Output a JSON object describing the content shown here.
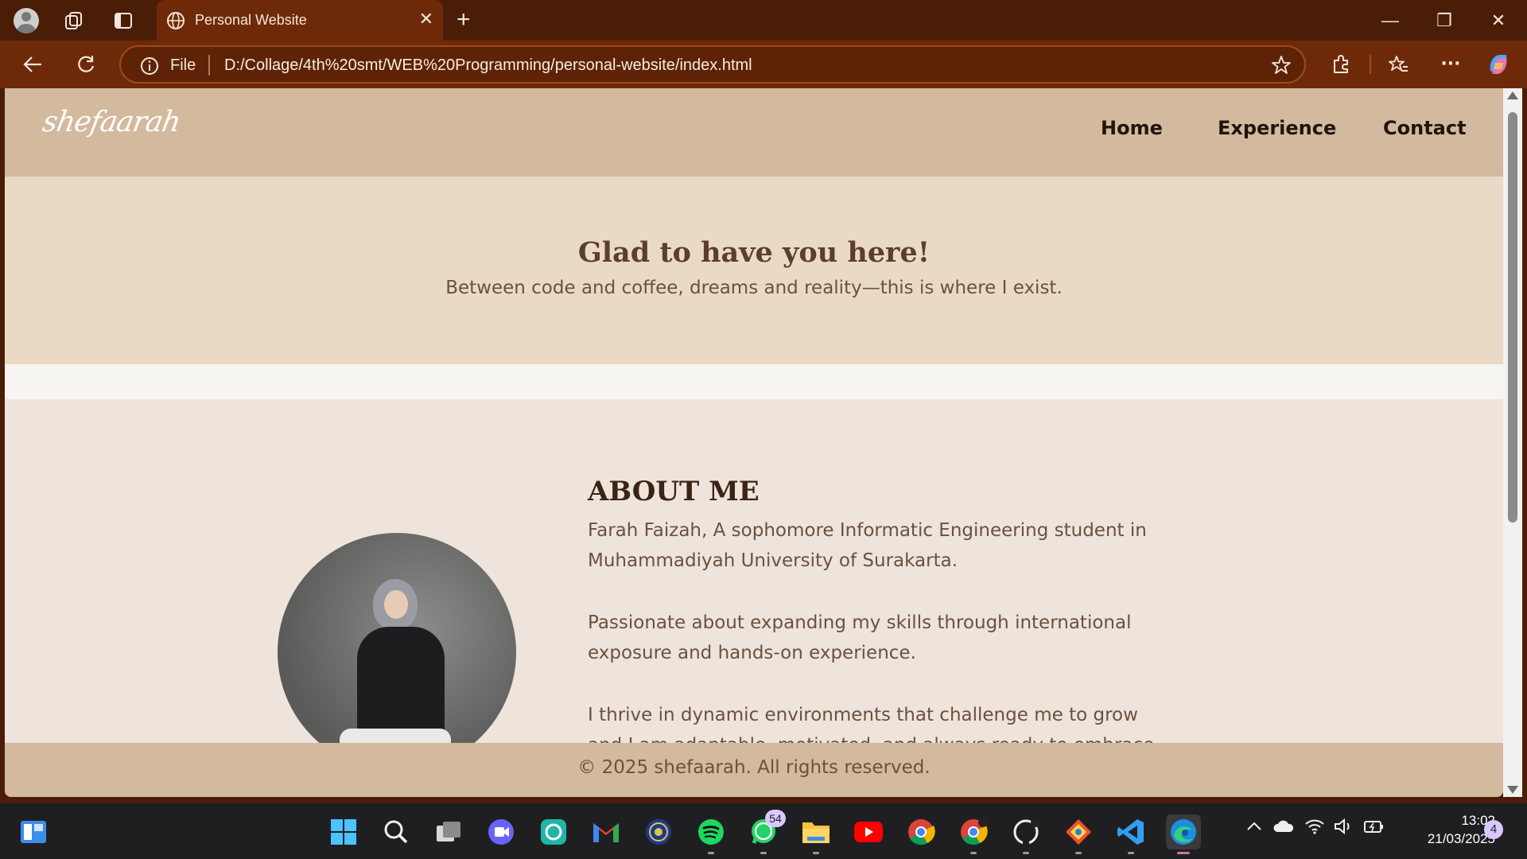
{
  "browser": {
    "tab_title": "Personal Website",
    "new_tab_label": "+",
    "address_scheme_label": "File",
    "address_url": "D:/Collage/4th%20smt/WEB%20Programming/personal-website/index.html",
    "accent_color": "#6e2a08",
    "icons": [
      "profile-icon",
      "collections-icon",
      "tab-actions-icon",
      "globe-icon",
      "close-icon",
      "back-icon",
      "reload-icon",
      "info-icon",
      "star-icon",
      "extensions-icon",
      "favorites-icon",
      "more-icon",
      "copilot-icon"
    ]
  },
  "site": {
    "logo": "shefaarah",
    "nav": {
      "home": "Home",
      "experience": "Experience",
      "contact": "Contact"
    },
    "hero": {
      "title": "Glad to have you here!",
      "subtitle": "Between code and coffee, dreams and reality—this is where I exist."
    },
    "about": {
      "heading": "ABOUT ME",
      "paragraphs": [
        "Farah Faizah, A sophomore Informatic Engineering student in Muhammadiyah University of Surakarta.",
        "Passionate about expanding my skills through international exposure and hands-on experience.",
        "I thrive in dynamic environments that challenge me to grow and I am adaptable, motivated, and always ready to embrace"
      ]
    },
    "footer": "© 2025 shefaarah. All rights reserved.",
    "colors": {
      "header": "#d3b99d",
      "hero": "#eadac5",
      "about": "#efe4db",
      "text": "#6a5140"
    }
  },
  "taskbar": {
    "apps": [
      "start",
      "search",
      "task-view",
      "meet",
      "copilot-chat",
      "gmail",
      "university",
      "spotify",
      "whatsapp",
      "file-explorer",
      "youtube",
      "chrome",
      "chrome-profile",
      "github",
      "git",
      "vscode",
      "edge"
    ],
    "whatsapp_badge": "54",
    "time": "13:02",
    "date": "21/03/2025",
    "notifications": "4"
  }
}
